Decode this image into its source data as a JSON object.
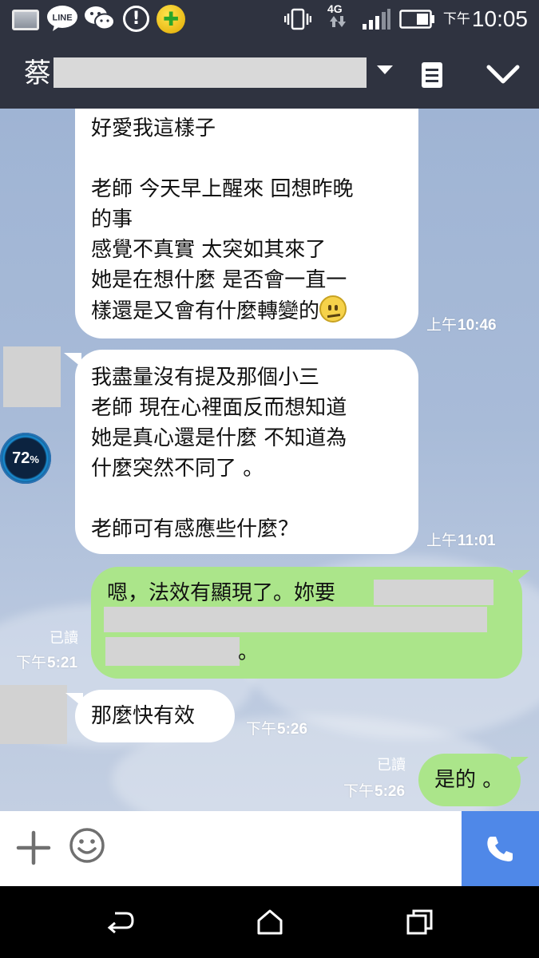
{
  "status_bar": {
    "network": "4G",
    "time_ampm": "下午",
    "time": "10:05"
  },
  "header": {
    "contact_name_visible": "蔡"
  },
  "float_badge": {
    "value": "72",
    "unit": "%"
  },
  "messages": [
    {
      "side": "in",
      "lines": [
        "好愛我這樣子",
        "",
        "老師 今天早上醒來 回想昨晚",
        "的事",
        "感覺不真實 太突如其來了",
        "她是在想什麼 是否會一直一",
        "樣還是又會有什麼轉變的"
      ],
      "emoji": "confused-face-emoji",
      "time_ampm": "上午",
      "time": "10:46"
    },
    {
      "side": "in",
      "lines": [
        "我盡量沒有提及那個小三",
        "老師 現在心裡面反而想知道",
        "她是真心還是什麼 不知道為",
        "什麼突然不同了 。",
        "",
        "老師可有感應些什麼？"
      ],
      "time_ampm": "上午",
      "time": "11:01"
    },
    {
      "side": "out",
      "lines": [
        "嗯，法效有顯現了。妳要"
      ],
      "trailing_visible": "。",
      "read_label": "已讀",
      "time_ampm": "下午",
      "time": "5:21"
    },
    {
      "side": "in",
      "lines": [
        "那麼快有效"
      ],
      "time_ampm": "下午",
      "time": "5:26"
    },
    {
      "side": "out",
      "lines": [
        "是的 。"
      ],
      "read_label": "已讀",
      "time_ampm": "下午",
      "time": "5:26"
    }
  ],
  "colors": {
    "header_bg": "#2f3340",
    "incoming_bubble": "#ffffff",
    "outgoing_bubble": "#abe58a",
    "call_button": "#4f88e8"
  }
}
